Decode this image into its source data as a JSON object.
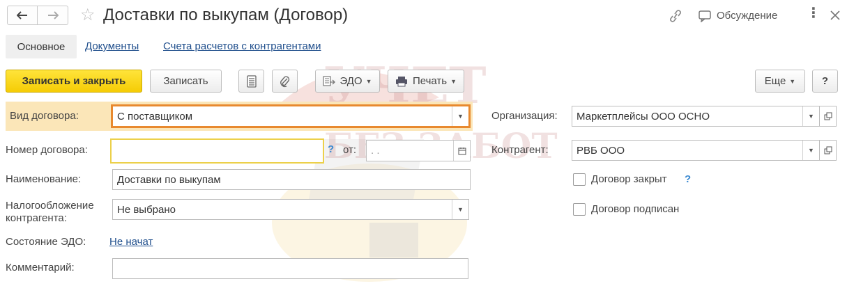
{
  "window": {
    "title": "Доставки по выкупам (Договор)",
    "discussion_label": "Обсуждение"
  },
  "tabs": [
    {
      "label": "Основное"
    },
    {
      "label": "Документы"
    },
    {
      "label": "Счета расчетов с контрагентами"
    }
  ],
  "toolbar": {
    "save_close_label": "Записать и закрыть",
    "save_label": "Записать",
    "edo_label": "ЭДО",
    "print_label": "Печать",
    "more_label": "Еще",
    "help_label": "?"
  },
  "form": {
    "contract_type": {
      "label": "Вид договора:",
      "value": "С поставщиком"
    },
    "contract_number": {
      "label": "Номер договора:",
      "value": "",
      "date_label": "от:",
      "date_value": ". ."
    },
    "name": {
      "label": "Наименование:",
      "value": "Доставки по выкупам"
    },
    "taxation": {
      "label": "Налогообложение контрагента:",
      "value": "Не выбрано"
    },
    "edo_state": {
      "label": "Состояние ЭДО:",
      "value": "Не начат"
    },
    "comment": {
      "label": "Комментарий:",
      "value": ""
    },
    "organization": {
      "label": "Организация:",
      "value": "Маркетплейсы ООО ОСНО"
    },
    "counterparty": {
      "label": "Контрагент:",
      "value": "РВБ ООО"
    },
    "contract_closed": {
      "label": "Договор закрыт",
      "checked": false
    },
    "contract_signed": {
      "label": "Договор подписан",
      "checked": false
    }
  },
  "watermark": {
    "line1": "УЧЕТ",
    "line2": "БЕЗ ЗАБОТ"
  },
  "colors": {
    "accent_yellow": "#f5cc05",
    "highlight_row": "#fbe6b8",
    "focus_orange": "#e8892e",
    "link_blue": "#1f4e8c"
  }
}
